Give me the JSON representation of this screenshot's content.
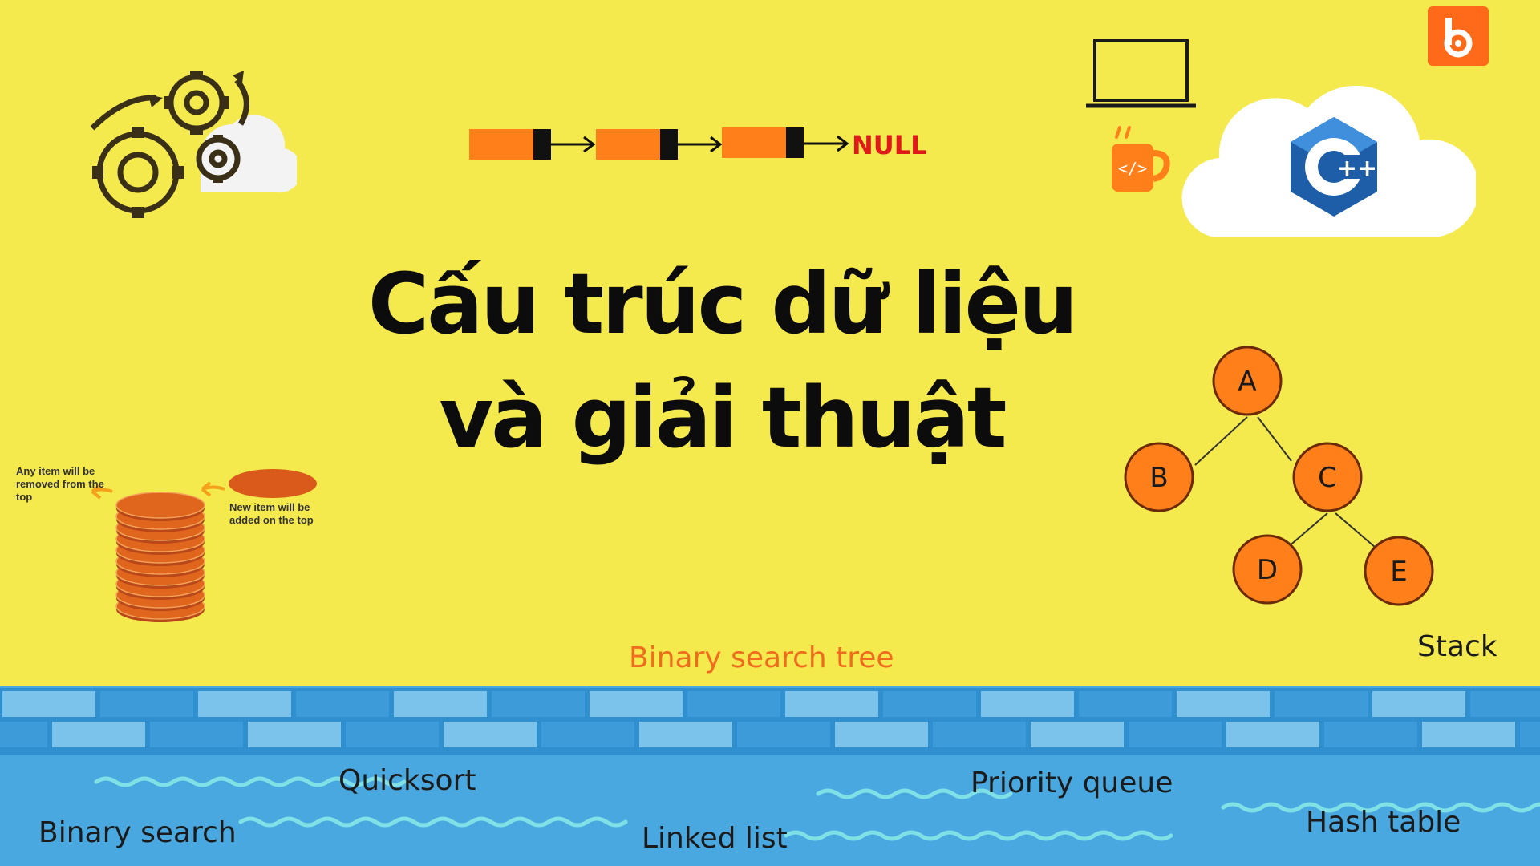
{
  "title": {
    "line1": "Cấu trúc dữ liệu",
    "line2": "và giải thuật"
  },
  "linked_list_diagram": {
    "end_label": "NULL"
  },
  "tree": {
    "nodes": [
      "A",
      "B",
      "C",
      "D",
      "E"
    ]
  },
  "stack_diagram": {
    "note_remove": "Any item will be removed from the top",
    "note_add": "New item will be added on the top"
  },
  "topics": {
    "binary_search_tree": "Binary search tree",
    "stack": "Stack",
    "quicksort": "Quicksort",
    "binary_search": "Binary search",
    "linked_list": "Linked list",
    "priority_queue": "Priority queue",
    "hash_table": "Hash table"
  },
  "colors": {
    "background": "#f4e94d",
    "accent_orange": "#ff7f1a",
    "water": "#4aa8e0",
    "brick_light": "#7cc3ec",
    "brick_dark": "#3e9bd9",
    "highlight_text": "#ef6c1e",
    "null_red": "#e01a1a"
  },
  "icons": [
    "gears-cloud-icon",
    "laptop-icon",
    "coffee-code-icon",
    "cpp-logo-icon",
    "brand-logo-icon"
  ]
}
